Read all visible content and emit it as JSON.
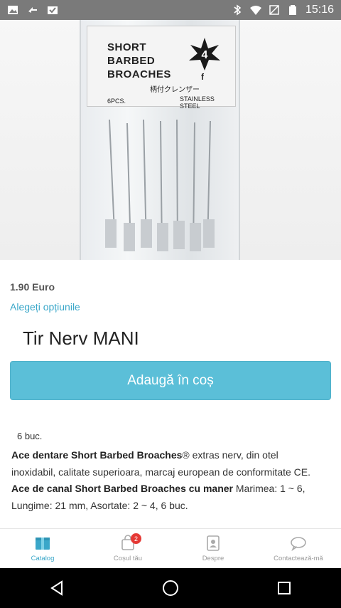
{
  "status_bar": {
    "time": "15:16",
    "left_icons": [
      "image-icon",
      "sync-icon",
      "inbox-check-icon"
    ],
    "right_icons": [
      "bluetooth-icon",
      "wifi-icon",
      "no-sim-icon",
      "battery-icon"
    ]
  },
  "product_image": {
    "label_lines": [
      "SHORT",
      "BARBED",
      "BROACHES"
    ],
    "size_number": "4",
    "size_letter": "f",
    "jp_text": "柄付クレンザー",
    "pcs_text": "6PCS.",
    "material_text": "STAINLESS STEEL"
  },
  "product": {
    "price": "1.90 Euro",
    "options_link": "Alegeți opțiunile",
    "title": "Tir Nerv MANI",
    "add_to_cart": "Adaugă în coș",
    "quantity": "6 buc.",
    "desc_p1_bold": "Ace dentare Short Barbed Broaches",
    "desc_p1_rest": "® extras nerv, din otel inoxidabil, calitate superioara, marcaj european de conformitate CE.",
    "desc_p2_bold": "Ace de canal Short Barbed Broaches cu maner",
    "desc_p2_rest": " Marimea: 1 ~ 6, Lungime: 21 mm, Asortate: 2 ~ 4, 6 buc."
  },
  "bottom_nav": {
    "items": [
      {
        "label": "Catalog",
        "icon": "catalog-icon"
      },
      {
        "label": "Coșul tău",
        "icon": "cart-icon",
        "badge": "2"
      },
      {
        "label": "Despre",
        "icon": "about-icon"
      },
      {
        "label": "Contactează-mă",
        "icon": "chat-icon"
      }
    ]
  },
  "colors": {
    "accent": "#3aa7c9",
    "button": "#5bbfd8",
    "badge": "#e53935",
    "status_bar": "#7a7a7a"
  }
}
